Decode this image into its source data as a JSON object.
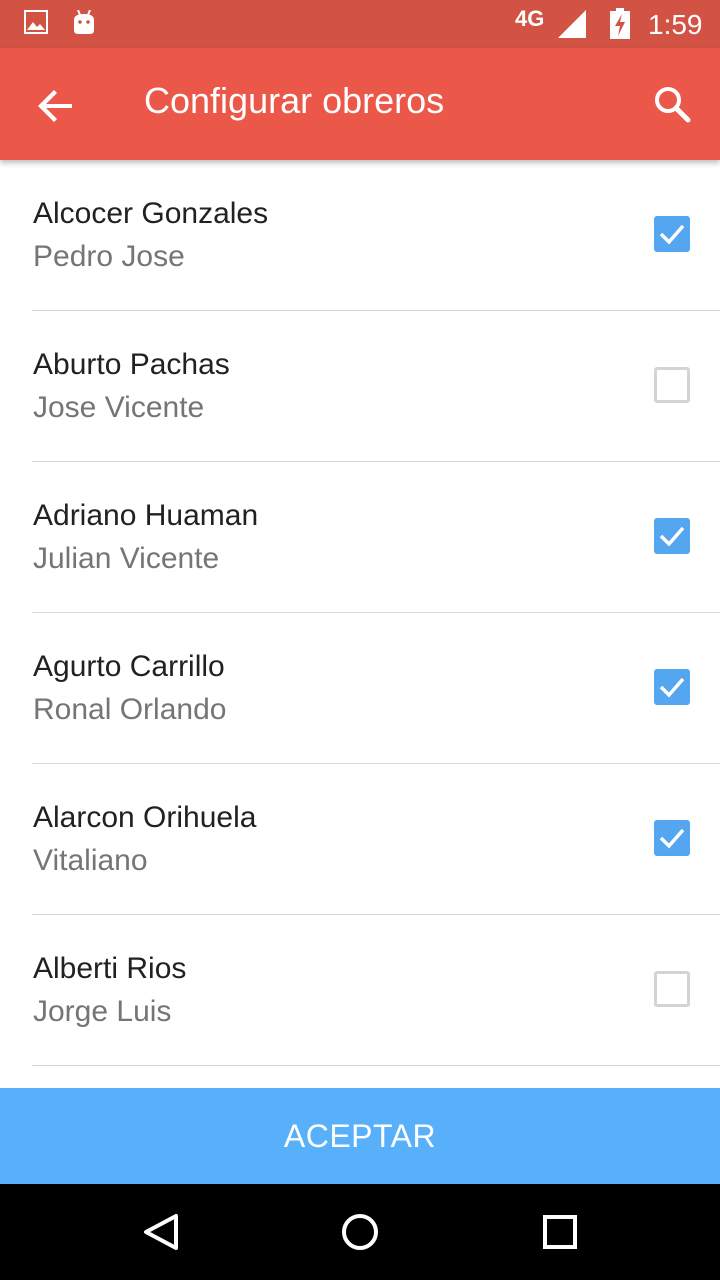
{
  "status_bar": {
    "network": "4G",
    "time": "1:59",
    "left_icons": [
      "image-icon",
      "android-icon"
    ],
    "right_icons": [
      "signal-icon",
      "battery-charging-icon"
    ]
  },
  "app_bar": {
    "title": "Configurar obreros",
    "back_icon": "arrow-back-icon",
    "search_icon": "search-icon",
    "color": "#eb5849"
  },
  "workers": [
    {
      "surname": "Alcocer Gonzales",
      "given": "Pedro Jose",
      "checked": true
    },
    {
      "surname": "Aburto Pachas",
      "given": "Jose Vicente",
      "checked": false
    },
    {
      "surname": "Adriano Huaman",
      "given": "Julian Vicente",
      "checked": true
    },
    {
      "surname": "Agurto Carrillo",
      "given": "Ronal Orlando",
      "checked": true
    },
    {
      "surname": "Alarcon Orihuela",
      "given": "Vitaliano",
      "checked": true
    },
    {
      "surname": "Alberti Rios",
      "given": "Jorge Luis",
      "checked": false
    }
  ],
  "accept_button": {
    "label": "ACEPTAR",
    "color": "#58b0fb"
  },
  "checkbox_color": "#55a6f0",
  "nav_bar": {
    "icons": [
      "back-triangle-icon",
      "home-circle-icon",
      "recents-square-icon"
    ]
  }
}
